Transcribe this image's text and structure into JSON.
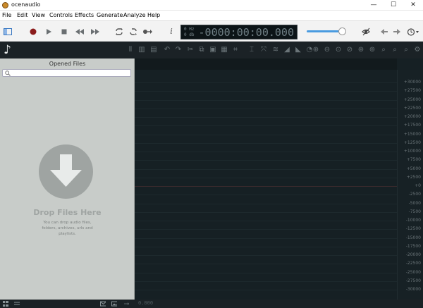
{
  "window": {
    "title": "ocenaudio",
    "minimize": "—",
    "maximize": "☐",
    "close": "✕"
  },
  "menu": [
    "File",
    "Edit",
    "View",
    "Controls",
    "Effects",
    "Generate",
    "Analyze",
    "Help"
  ],
  "toolbar": {
    "info_glyph": "i",
    "lcd_freq": "0 Hz",
    "lcd_db": "0 db",
    "lcd_time": "-0000:00:00.000",
    "volume_level": 1.0
  },
  "sidebar": {
    "logo": "♪",
    "panel_title": "Opened Files",
    "search_placeholder": "",
    "drop_title": "Drop Files Here",
    "drop_description": "You can drop audio files, folders, archives, urls and playlists."
  },
  "ruler_ticks": [
    "+30000",
    "+27500",
    "+25000",
    "+22500",
    "+20000",
    "+17500",
    "+15000",
    "+12500",
    "+10000",
    "+7500",
    "+5000",
    "+2500",
    "+0",
    "-2500",
    "-5000",
    "-7500",
    "-10000",
    "-12500",
    "-15000",
    "-17500",
    "-20000",
    "-22500",
    "-25000",
    "-27500",
    "-30000"
  ],
  "statusbar": {
    "position": "0.000"
  }
}
